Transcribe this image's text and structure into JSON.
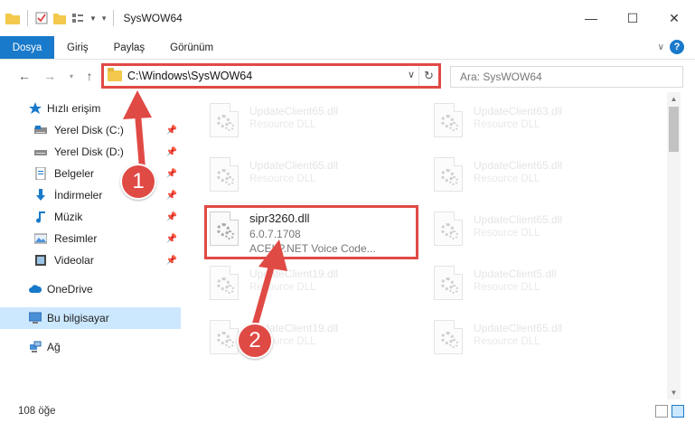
{
  "window": {
    "title": "SysWOW64",
    "controls": {
      "minimize": "—",
      "maximize": "☐",
      "close": "✕"
    }
  },
  "ribbon": {
    "tabs": [
      "Dosya",
      "Giriş",
      "Paylaş",
      "Görünüm"
    ],
    "help": "?"
  },
  "address": {
    "path": "C:\\Windows\\SysWOW64",
    "search_placeholder": "Ara: SysWOW64"
  },
  "nav": {
    "items": [
      {
        "label": "Hızlı erişim",
        "icon": "star-icon"
      },
      {
        "label": "Yerel Disk (C:)",
        "icon": "drive-icon",
        "pinned": true
      },
      {
        "label": "Yerel Disk (D:)",
        "icon": "drive-icon",
        "pinned": true
      },
      {
        "label": "Belgeler",
        "icon": "documents-icon",
        "pinned": true
      },
      {
        "label": "İndirmeler",
        "icon": "download-icon",
        "pinned": true
      },
      {
        "label": "Müzik",
        "icon": "music-icon",
        "pinned": true
      },
      {
        "label": "Resimler",
        "icon": "pictures-icon",
        "pinned": true
      },
      {
        "label": "Videolar",
        "icon": "videos-icon",
        "pinned": true
      },
      {
        "label": "OneDrive",
        "icon": "cloud-icon"
      },
      {
        "label": "Bu bilgisayar",
        "icon": "computer-icon",
        "selected": true
      },
      {
        "label": "Ağ",
        "icon": "network-icon"
      }
    ]
  },
  "files": [
    {
      "name": "UpdateClient65.dll",
      "type": "Resource DLL"
    },
    {
      "name": "UpdateClient63.dll",
      "type": "Resource DLL"
    },
    {
      "name": "UpdateClient65.dll",
      "type": "Resource DLL"
    },
    {
      "name": "UpdateClient65.dll",
      "type": "Resource DLL"
    },
    {
      "name": "sipr3260.dll",
      "version": "6.0.7.1708",
      "description": "ACELP.NET Voice Code..."
    },
    {
      "name": "UpdateClient65.dll",
      "type": "Resource DLL"
    },
    {
      "name": "UpdateClient19.dll",
      "type": "Resource DLL"
    },
    {
      "name": "UpdateClient5.dll",
      "type": "Resource DLL"
    },
    {
      "name": "UpdateClient19.dll",
      "type": "Resource DLL"
    },
    {
      "name": "UpdateClient65.dll",
      "type": "Resource DLL"
    }
  ],
  "status": {
    "count": "108 öğe"
  },
  "annotations": {
    "step1": "1",
    "step2": "2"
  },
  "colors": {
    "accent": "#1979ca",
    "highlight": "#e04a45",
    "selected": "#cce8ff"
  }
}
